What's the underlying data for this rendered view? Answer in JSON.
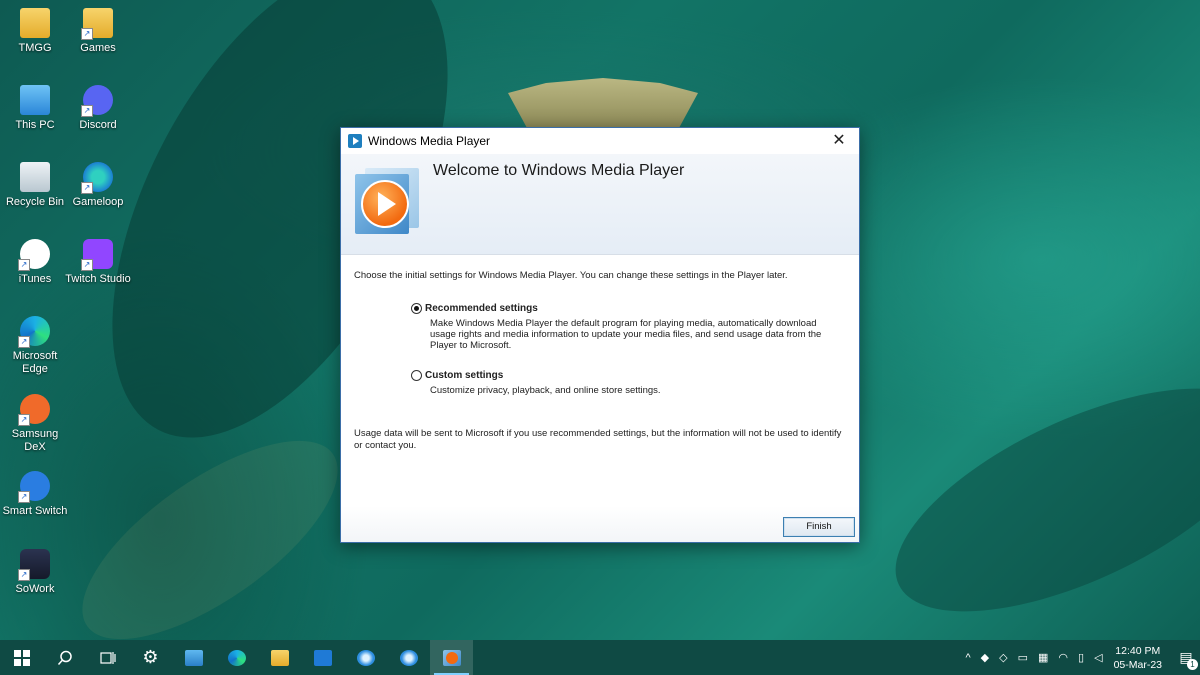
{
  "desktop": {
    "icons": [
      {
        "label": "TMGG",
        "icon": "folder-icon"
      },
      {
        "label": "Games",
        "icon": "folder-icon"
      },
      {
        "label": "This PC",
        "icon": "computer-icon"
      },
      {
        "label": "Discord",
        "icon": "discord-icon"
      },
      {
        "label": "Recycle Bin",
        "icon": "recycle-bin-icon"
      },
      {
        "label": "Gameloop",
        "icon": "gameloop-icon"
      },
      {
        "label": "iTunes",
        "icon": "itunes-icon"
      },
      {
        "label": "Twitch Studio",
        "icon": "twitch-icon"
      },
      {
        "label": "Microsoft Edge",
        "icon": "edge-icon"
      },
      {
        "label": "Samsung DeX",
        "icon": "samsung-dex-icon"
      },
      {
        "label": "Smart Switch",
        "icon": "smart-switch-icon"
      },
      {
        "label": "SoWork",
        "icon": "sowork-icon"
      }
    ]
  },
  "dialog": {
    "title": "Windows Media Player",
    "heading": "Welcome to Windows Media Player",
    "intro": "Choose the initial settings for Windows Media Player. You can change these settings in the Player later.",
    "options": [
      {
        "label": "Recommended settings",
        "selected": true,
        "description": "Make Windows Media Player the default program for playing media, automatically download usage rights and media information to update your media files, and send usage data from the Player to Microsoft."
      },
      {
        "label": "Custom settings",
        "selected": false,
        "description": "Customize privacy, playback, and online store settings."
      }
    ],
    "note": "Usage data will be sent to Microsoft if you use recommended settings, but the information will not be used to identify or contact you.",
    "finish_label": "Finish",
    "close_glyph": "✕"
  },
  "taskbar": {
    "apps": [
      "start-icon",
      "search-icon",
      "task-view-icon",
      "settings-icon",
      "control-panel-icon",
      "edge-icon",
      "file-explorer-icon",
      "mail-icon",
      "app-blue-icon",
      "app-blue-icon",
      "windows-media-player-icon"
    ],
    "active_app": "windows-media-player-icon",
    "tray": {
      "time": "12:40 PM",
      "date": "05-Mar-23",
      "notification_count": "1"
    }
  }
}
